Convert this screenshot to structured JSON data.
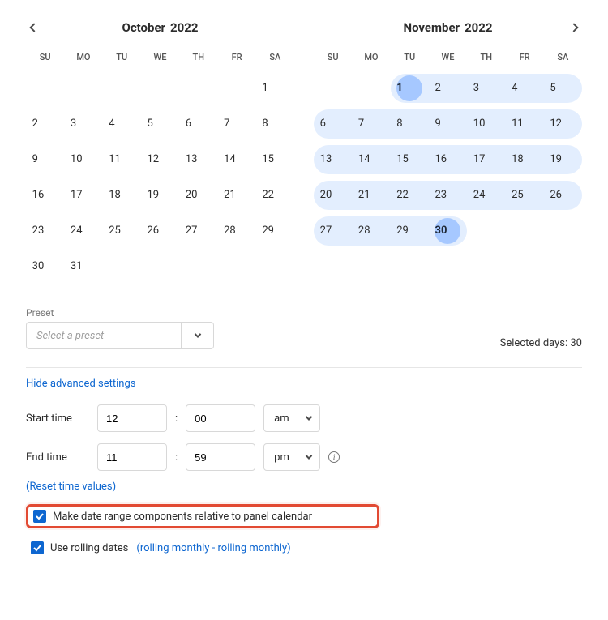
{
  "calendars": [
    {
      "month": "October",
      "year": "2022",
      "show_prev": true,
      "show_next": false,
      "dow": [
        "SU",
        "MO",
        "TU",
        "WE",
        "TH",
        "FR",
        "SA"
      ],
      "weeks": [
        {
          "days": [
            "",
            "",
            "",
            "",
            "",
            "",
            "1"
          ],
          "range_start": null,
          "range_end": null
        },
        {
          "days": [
            "2",
            "3",
            "4",
            "5",
            "6",
            "7",
            "8"
          ],
          "range_start": null,
          "range_end": null
        },
        {
          "days": [
            "9",
            "10",
            "11",
            "12",
            "13",
            "14",
            "15"
          ],
          "range_start": null,
          "range_end": null
        },
        {
          "days": [
            "16",
            "17",
            "18",
            "19",
            "20",
            "21",
            "22"
          ],
          "range_start": null,
          "range_end": null
        },
        {
          "days": [
            "23",
            "24",
            "25",
            "26",
            "27",
            "28",
            "29"
          ],
          "range_start": null,
          "range_end": null
        },
        {
          "days": [
            "30",
            "31",
            "",
            "",
            "",
            "",
            ""
          ],
          "range_start": null,
          "range_end": null
        }
      ],
      "sel_start": null,
      "sel_end": null
    },
    {
      "month": "November",
      "year": "2022",
      "show_prev": false,
      "show_next": true,
      "dow": [
        "SU",
        "MO",
        "TU",
        "WE",
        "TH",
        "FR",
        "SA"
      ],
      "weeks": [
        {
          "days": [
            "",
            "",
            "1",
            "2",
            "3",
            "4",
            "5"
          ],
          "range_start": 2,
          "range_end": 6
        },
        {
          "days": [
            "6",
            "7",
            "8",
            "9",
            "10",
            "11",
            "12"
          ],
          "range_start": 0,
          "range_end": 6
        },
        {
          "days": [
            "13",
            "14",
            "15",
            "16",
            "17",
            "18",
            "19"
          ],
          "range_start": 0,
          "range_end": 6
        },
        {
          "days": [
            "20",
            "21",
            "22",
            "23",
            "24",
            "25",
            "26"
          ],
          "range_start": 0,
          "range_end": 6
        },
        {
          "days": [
            "27",
            "28",
            "29",
            "30",
            "",
            "",
            ""
          ],
          "range_start": 0,
          "range_end": 3
        },
        {
          "days": [
            "",
            "",
            "",
            "",
            "",
            "",
            ""
          ],
          "range_start": null,
          "range_end": null
        }
      ],
      "sel_start": {
        "week": 0,
        "col": 2
      },
      "sel_end": {
        "week": 4,
        "col": 3
      }
    }
  ],
  "preset": {
    "label": "Preset",
    "placeholder": "Select a preset"
  },
  "summary": {
    "label": "Selected days:",
    "value": "30"
  },
  "advanced_toggle": "Hide advanced settings",
  "time": {
    "start_label": "Start time",
    "end_label": "End time",
    "start_hour": "12",
    "start_minute": "00",
    "start_ampm": "am",
    "end_hour": "11",
    "end_minute": "59",
    "end_ampm": "pm",
    "reset_label": "(Reset time values)"
  },
  "checkbox1": {
    "checked": true,
    "label": "Make date range components relative to panel calendar"
  },
  "checkbox2": {
    "checked": true,
    "label": "Use rolling dates",
    "hint": "(rolling monthly - rolling monthly)"
  }
}
